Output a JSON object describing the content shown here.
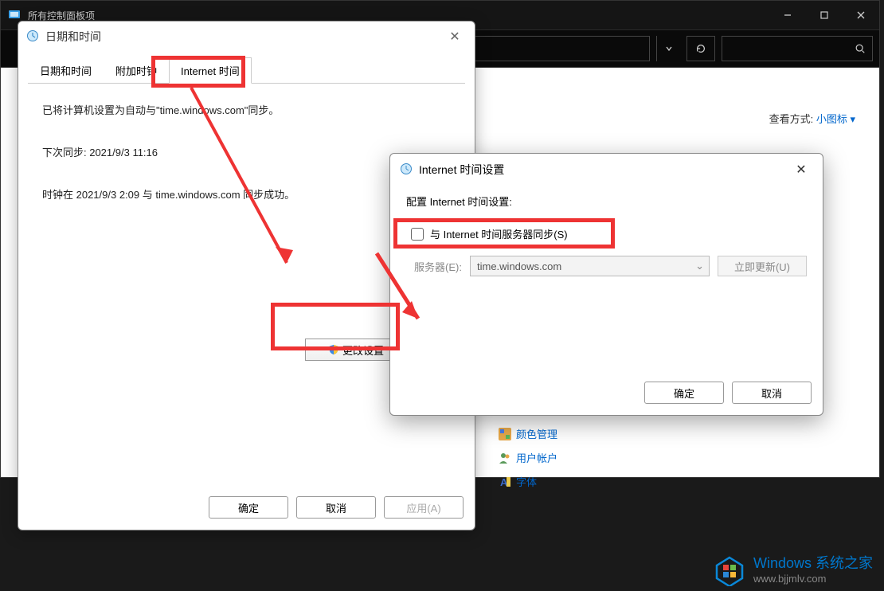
{
  "main_window": {
    "title": "所有控制面板项",
    "view_by_label": "查看方式:",
    "view_by_value": "小图标 ▾",
    "cp_items": {
      "color": "颜色管理",
      "user": "用户帐户",
      "font": "字体"
    }
  },
  "dialog_datetime": {
    "title": "日期和时间",
    "tabs": [
      "日期和时间",
      "附加时钟",
      "Internet 时间"
    ],
    "active_tab_index": 2,
    "line_sync_info": "已将计算机设置为自动与\"time.windows.com\"同步。",
    "line_next_sync": "下次同步: 2021/9/3 11:16",
    "line_success": "时钟在 2021/9/3 2:09 与 time.windows.com 同步成功。",
    "change_settings_btn": "更改设置",
    "ok_btn": "确定",
    "cancel_btn": "取消",
    "apply_btn": "应用(A)"
  },
  "dialog_itime": {
    "title": "Internet 时间设置",
    "subtitle": "配置 Internet 时间设置:",
    "sync_checkbox_label": "与 Internet 时间服务器同步(S)",
    "server_label": "服务器(E):",
    "server_value": "time.windows.com",
    "update_now_btn": "立即更新(U)",
    "ok_btn": "确定",
    "cancel_btn": "取消"
  },
  "watermark": {
    "line1": "Windows 系统之家",
    "line2": "www.bjjmlv.com"
  }
}
